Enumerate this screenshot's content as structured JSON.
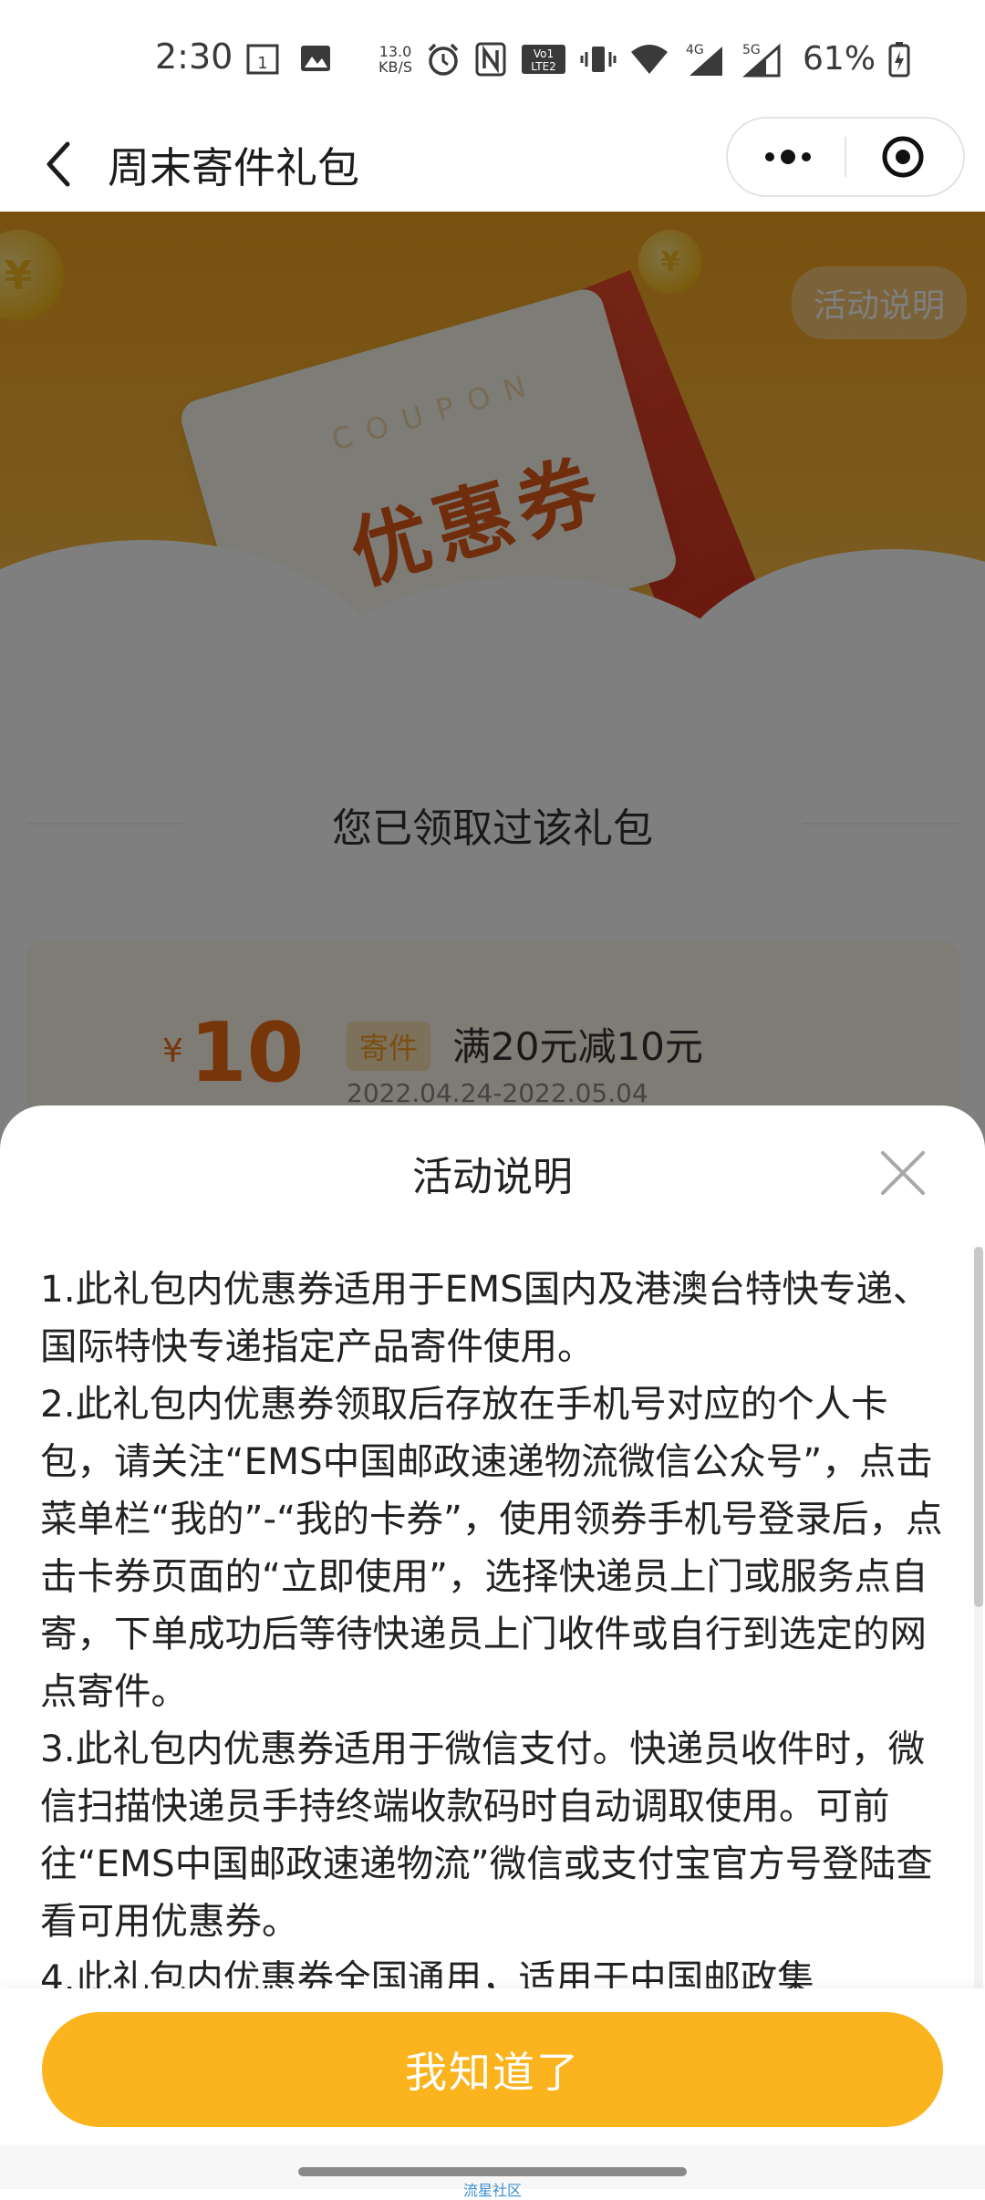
{
  "status_bar": {
    "time": "2:30",
    "net_speed_value": "13.0",
    "net_speed_unit": "KB/S",
    "network_labels": [
      "4G",
      "5G"
    ],
    "volte_label": "Vo LTE 2",
    "battery": "61%"
  },
  "header": {
    "title": "周末寄件礼包"
  },
  "banner": {
    "activity_button": "活动说明",
    "coupon_word": "COUPON",
    "coupon_title": "优惠券",
    "coin_symbol": "¥"
  },
  "page": {
    "claimed_text": "您已领取过该礼包",
    "coupon": {
      "currency": "¥",
      "amount": "10",
      "tag": "寄件",
      "condition": "满20元减10元",
      "date": "2022.04.24-2022.05.04"
    }
  },
  "sheet": {
    "title": "活动说明",
    "paragraphs": [
      "1.此礼包内优惠券适用于EMS国内及港澳台特快专递、国际特快专递指定产品寄件使用。",
      "2.此礼包内优惠券领取后存放在手机号对应的个人卡包，请关注“EMS中国邮政速递物流微信公众号”，点击菜单栏“我的”-“我的卡券”，使用领券手机号登录后，点击卡券页面的“立即使用”，选择快递员上门或服务点自寄，下单成功后等待快递员上门收件或自行到选定的网点寄件。",
      "3.此礼包内优惠券适用于微信支付。快递员收件时，微信扫描快递员手持终端收款码时自动调取使用。可前往“EMS中国邮政速递物流”微信或支付宝官方号登陆查看可用优惠券。",
      "4.此礼包内优惠券全国通用，适用于中国邮政集"
    ],
    "ok_button": "我知道了"
  },
  "nav": {
    "watermark": "流星社区"
  },
  "colors": {
    "accent": "#fbb31e",
    "banner": "#f1a21e",
    "price": "#ee6b14"
  }
}
